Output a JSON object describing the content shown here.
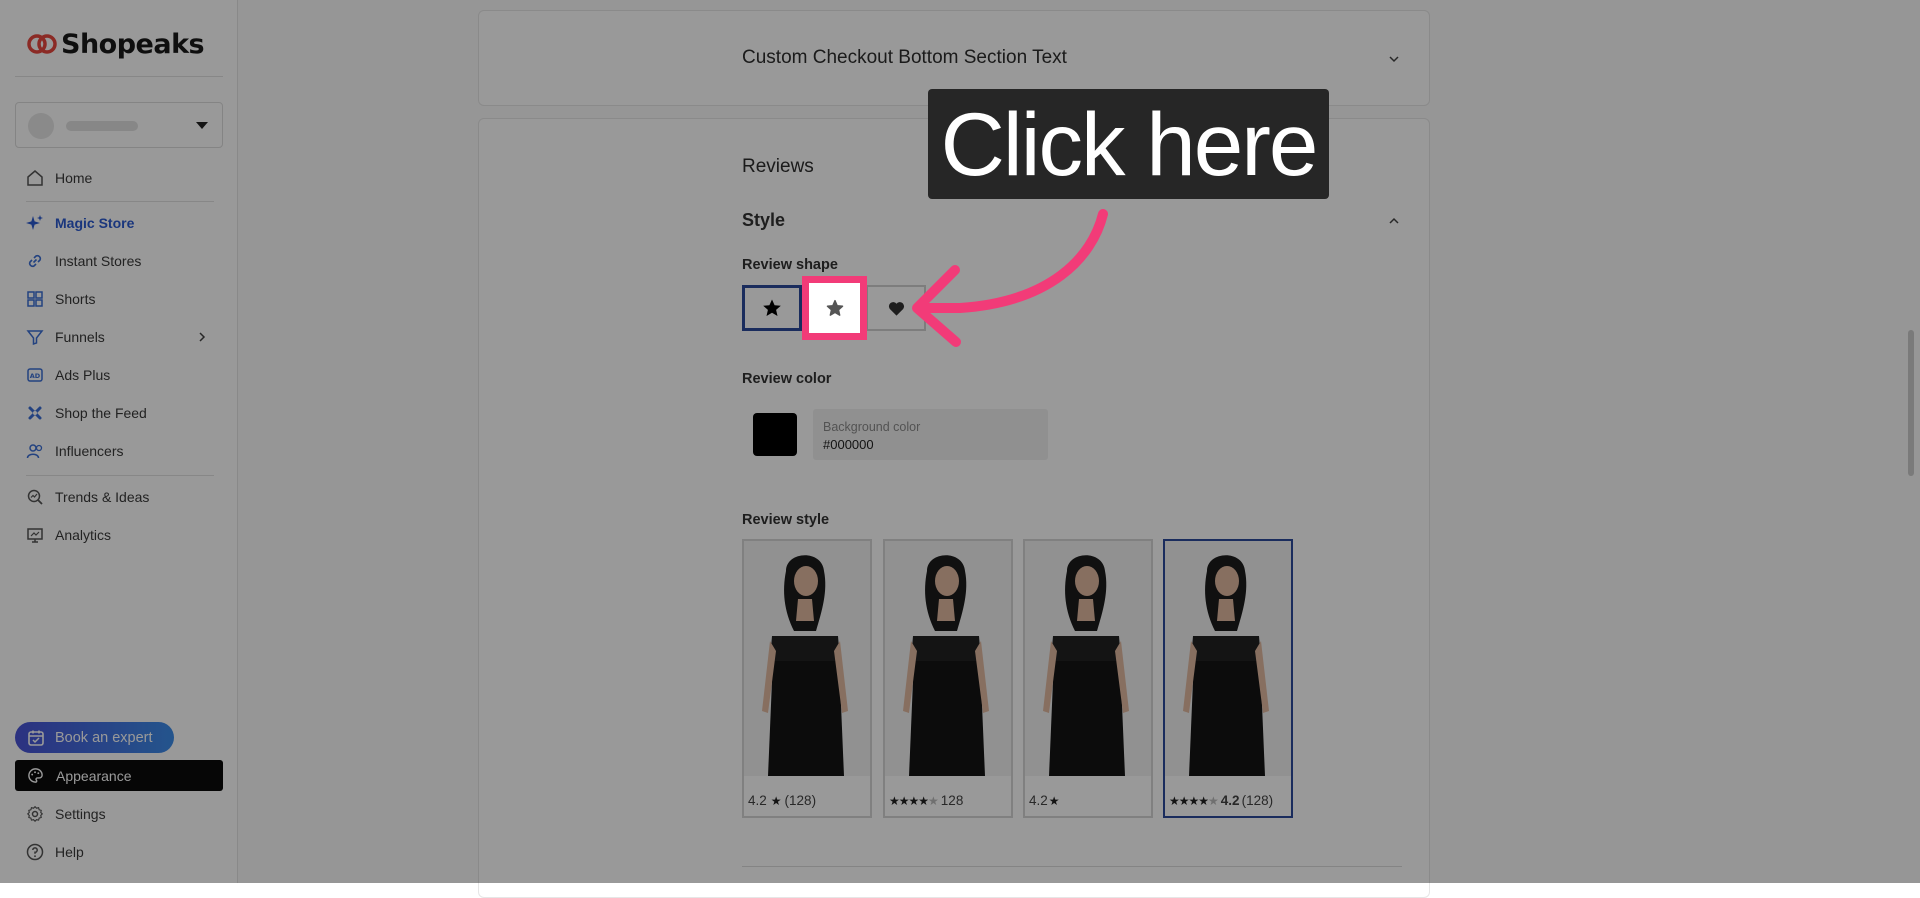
{
  "brand": {
    "name": "Shopeaks"
  },
  "store_selector": {
    "name": ""
  },
  "sidebar": {
    "items": [
      {
        "label": "Home",
        "icon": "home-icon"
      },
      {
        "label": "Magic Store",
        "icon": "sparkle-icon",
        "active": true
      },
      {
        "label": "Instant Stores",
        "icon": "link-icon"
      },
      {
        "label": "Shorts",
        "icon": "grid-icon"
      },
      {
        "label": "Funnels",
        "icon": "funnel-icon",
        "has_submenu": true
      },
      {
        "label": "Ads Plus",
        "icon": "ad-icon"
      },
      {
        "label": "Shop the Feed",
        "icon": "feed-icon"
      },
      {
        "label": "Influencers",
        "icon": "users-icon"
      },
      {
        "label": "Trends & Ideas",
        "icon": "trends-icon"
      },
      {
        "label": "Analytics",
        "icon": "analytics-icon"
      }
    ],
    "book_expert": "Book an expert",
    "appearance": "Appearance",
    "settings": "Settings",
    "help": "Help"
  },
  "main": {
    "checkout_section": "Custom Checkout Bottom Section Text",
    "reviews": {
      "title": "Reviews",
      "style_heading": "Style",
      "shape_label": "Review shape",
      "shapes": [
        "star-filled",
        "star-rounded",
        "heart"
      ],
      "color_label": "Review color",
      "color_field_label": "Background color",
      "color_value": "#000000",
      "style_label": "Review style",
      "styles": [
        {
          "rating": "4.2",
          "count": "(128)"
        },
        {
          "stars": 4,
          "count": "128"
        },
        {
          "rating": "4.2"
        },
        {
          "stars": 4,
          "rating": "4.2",
          "count": "(128)",
          "selected": true
        }
      ]
    }
  },
  "overlay": {
    "tooltip": "Click here",
    "accent": "#f23b78"
  },
  "colors": {
    "brand_red": "#e8473e",
    "active_blue": "#2c5bd0",
    "selected_border": "#2c4a9c"
  }
}
